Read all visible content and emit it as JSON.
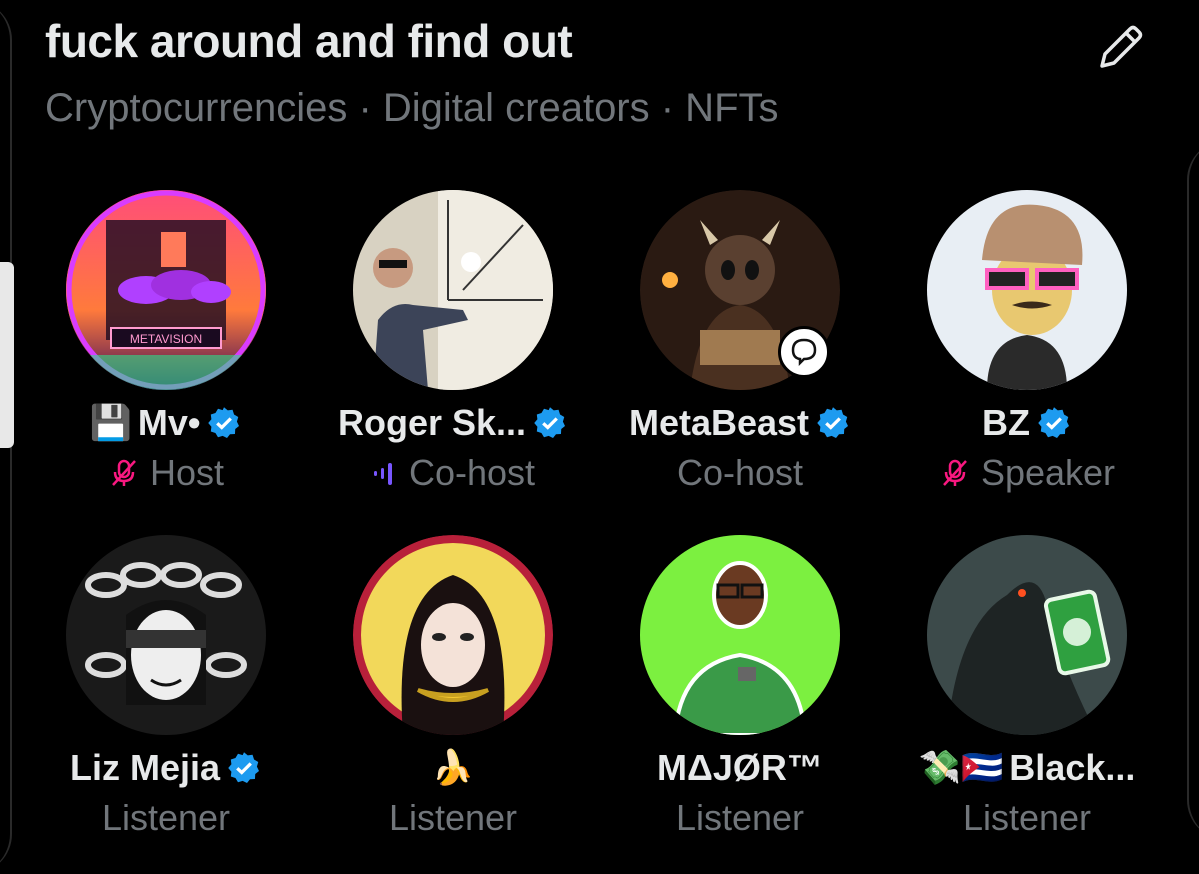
{
  "space": {
    "title": "fuck around and find out",
    "topics": "Cryptocurrencies · Digital creators · NFTs"
  },
  "participants": [
    {
      "name": "Mv•",
      "prefix_emoji": "💾",
      "role": "Host",
      "verified": true,
      "status_icon": "mic-off-icon"
    },
    {
      "name": "Roger Sk...",
      "role": "Co-host",
      "verified": true,
      "status_icon": "audio-wave-icon"
    },
    {
      "name": "MetaBeast",
      "role": "Co-host",
      "verified": true,
      "status_icon": "",
      "avatar_badge": "speech-bubble-icon"
    },
    {
      "name": "BZ",
      "role": "Speaker",
      "verified": true,
      "status_icon": "mic-off-icon"
    },
    {
      "name": "Liz Mejia",
      "role": "Listener",
      "verified": true
    },
    {
      "name": "🍌",
      "role": "Listener",
      "verified": false
    },
    {
      "name": "MΔJØR™",
      "role": "Listener",
      "verified": false
    },
    {
      "name": "Black...",
      "prefix_emoji": "💸🇨🇺",
      "role": "Listener",
      "verified": false
    }
  ],
  "colors": {
    "background": "#000000",
    "text_primary": "#e7e9ea",
    "text_secondary": "#71767b",
    "verified_blue": "#1d9bf0",
    "mic_off_pink": "#f91880",
    "wave_purple": "#7856ff"
  }
}
